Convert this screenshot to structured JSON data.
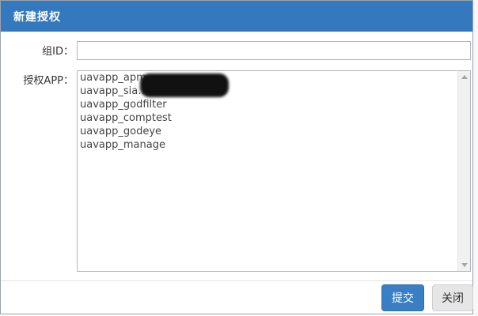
{
  "dialog": {
    "title": "新建授权",
    "group_label": "组ID：",
    "group_value": "",
    "app_label": "授权APP：",
    "apps": [
      "uavapp_apm",
      "uavapp_sia…8070",
      "uavapp_godfilter",
      "uavapp_comptest",
      "uavapp_godeye",
      "uavapp_manage"
    ],
    "submit_label": "提交",
    "close_label": "关闭"
  },
  "colors": {
    "header": "#3478be",
    "submit": "#3a7fc4",
    "close": "#e6e6e6"
  }
}
